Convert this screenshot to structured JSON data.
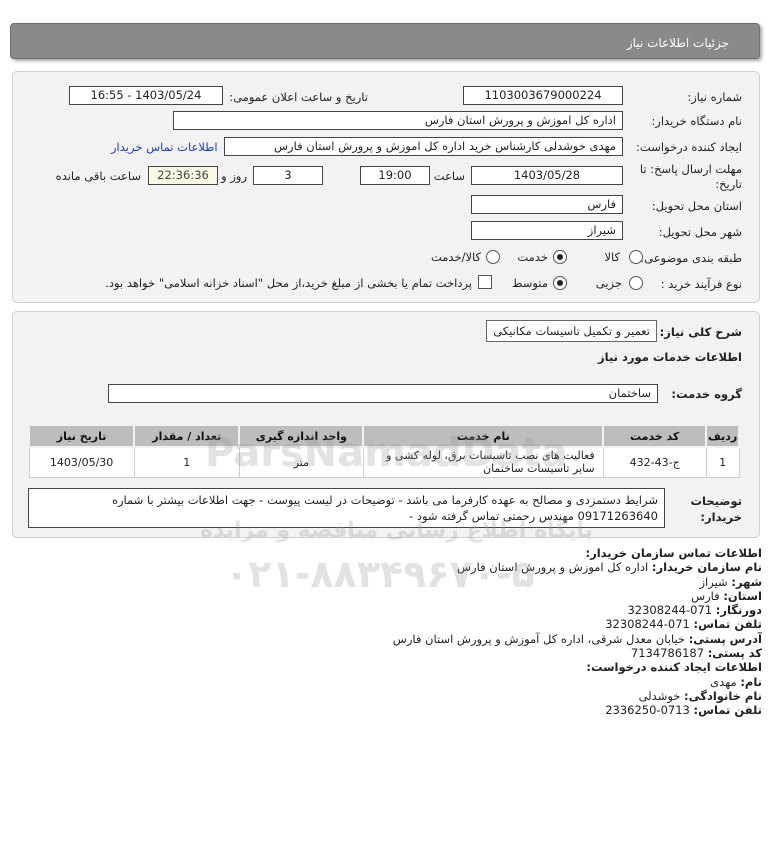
{
  "header": {
    "title": "جزئیات اطلاعات نیاز"
  },
  "form": {
    "need_number_label": "شماره نیاز:",
    "need_number": "1103003679000224",
    "announce_label": "تاریخ و ساعت اعلان عمومی:",
    "announce_value": "1403/05/24 - 16:55",
    "buyer_org_label": "نام دستگاه خریدار:",
    "buyer_org": "اداره کل اموزش و پرورش استان فارس",
    "creator_label": "ایجاد کننده درخواست:",
    "creator": "مهدی خوشدلی کارشناس خرید اداره کل اموزش و پرورش استان فارس",
    "contact_link": "اطلاعات تماس خریدار",
    "deadline_label_1": "مهلت ارسال پاسخ: تا",
    "deadline_label_2": "تاریخ:",
    "deadline_date": "1403/05/28",
    "time_label": "ساعت",
    "deadline_time": "19:00",
    "days_value": "3",
    "days_label": "روز و",
    "remaining_time": "22:36:36",
    "remaining_label": "ساعت باقی مانده",
    "province_label": "استان محل تحویل:",
    "province": "فارس",
    "city_label": "شهر محل تحویل:",
    "city": "شیراز",
    "category_label": "طبقه بندی موضوعی:",
    "category_options": [
      "کالا",
      "خدمت",
      "کالا/خدمت"
    ],
    "category_selected": "خدمت",
    "process_label": "نوع فرآیند خرید :",
    "process_options": [
      "جزیی",
      "متوسط"
    ],
    "process_selected": "متوسط",
    "payment_text": "پرداخت تمام یا بخشی از مبلغ خرید،از محل \"اسناد خزانه اسلامی\" خواهد بود."
  },
  "need": {
    "summary_label": "شرح کلی نیاز:",
    "summary": "تعمیر و تکمیل تاسیسات مکانیکی",
    "services_heading": "اطلاعات خدمات مورد نیاز",
    "service_group_label": "گروه خدمت:",
    "service_group": "ساختمان",
    "table": {
      "headers": [
        "ردیف",
        "کد خدمت",
        "نام خدمت",
        "واحد اندازه گیری",
        "تعداد / مقدار",
        "تاریخ نیاز"
      ],
      "rows": [
        {
          "row": "1",
          "code": "ج-43-432",
          "name": "فعالیت های نصب تاسیسات برق، لوله کشی و سایر تاسیسات ساختمان",
          "unit": "متر",
          "qty": "1",
          "date": "1403/05/30"
        }
      ]
    },
    "buyer_notes_label_1": "توضیحات",
    "buyer_notes_label_2": "خریدار:",
    "buyer_notes": "شرایط دستمزدی و مصالح به عهده کارفرما می باشد - توضیحات در لیست پیوست - جهت اطلاعات بیشتر با شماره 09171263640 مهندس رحمتی تماس گرفته شود -"
  },
  "contact": {
    "org_heading": "اطلاعات تماس سازمان خریدار:",
    "rows": [
      {
        "label": "نام سازمان خریدار:",
        "value": "اداره کل اموزش و پرورش استان فارس"
      },
      {
        "label": "شهر:",
        "value": "شیراز"
      },
      {
        "label": "استان:",
        "value": "فارس"
      },
      {
        "label": "دورنگار:",
        "value": "071-32308244"
      },
      {
        "label": "تلفن تماس:",
        "value": "071-32308244"
      },
      {
        "label": "آدرس پستی:",
        "value": "خیابان معدل شرقی، اداره کل آموزش و پرورش استان فارس"
      },
      {
        "label": "کد پستی:",
        "value": "7134786187"
      }
    ],
    "creator_heading": "اطلاعات ایجاد کننده درخواست:",
    "creator_rows": [
      {
        "label": "نام:",
        "value": "مهدی"
      },
      {
        "label": "نام خانوادگی:",
        "value": "خوشدلی"
      },
      {
        "label": "تلفن تماس:",
        "value": "0713-2336250"
      }
    ]
  },
  "watermark": {
    "brand": "ParsNamadData",
    "caption": "پایگاه اطلاع رسانی مناقصه و مزایده",
    "phone": "۰۲۱-۸۸۳۴۹۶۷۰-۵"
  }
}
